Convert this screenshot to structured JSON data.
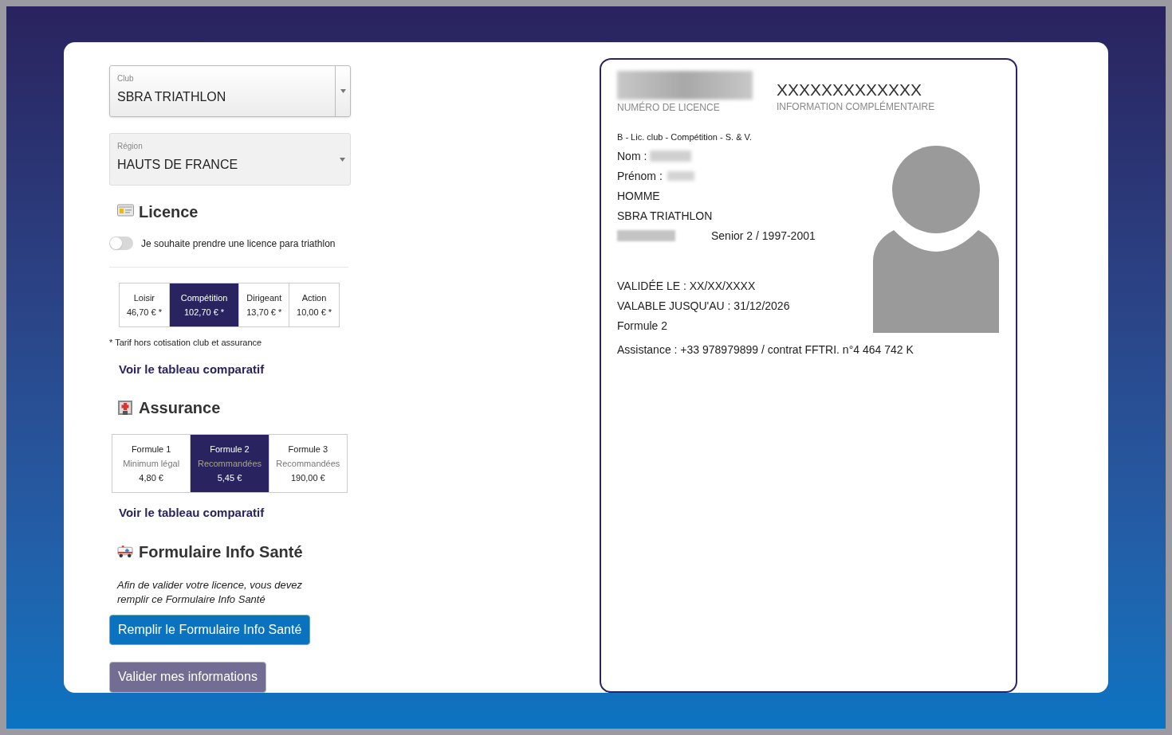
{
  "form": {
    "selects": [
      {
        "kind": "split",
        "label": "Club",
        "value": "SBRA TRIATHLON"
      },
      {
        "kind": "plain",
        "label": "Région",
        "value": "HAUTS DE FRANCE"
      }
    ],
    "licence": {
      "heading": "Licence",
      "toggle": {
        "label": "Je souhaite prendre une licence para triathlon",
        "on": false
      },
      "options": [
        {
          "name": "Loisir",
          "price": "46,70 € *",
          "selected": false
        },
        {
          "name": "Compétition",
          "price": "102,70 € *",
          "selected": true
        },
        {
          "name": "Dirigeant",
          "price": "13,70 € *",
          "selected": false
        },
        {
          "name": "Action",
          "price": "10,00 € *",
          "selected": false
        }
      ],
      "note": "* Tarif hors cotisation club et assurance",
      "link": "Voir le tableau comparatif"
    },
    "assurance": {
      "heading": "Assurance",
      "options": [
        {
          "name": "Formule 1",
          "subtitle": "Minimum légal",
          "price": "4,80 €",
          "selected": false
        },
        {
          "name": "Formule 2",
          "subtitle": "Recommandées",
          "price": "5,45 €",
          "selected": true
        },
        {
          "name": "Formule 3",
          "subtitle": "Recommandées",
          "price": "190,00 €",
          "selected": false
        }
      ],
      "link": "Voir le tableau comparatif"
    },
    "sante": {
      "heading": "Formulaire Info Santé",
      "text": "Afin de valider votre licence, vous devez remplir ce Formulaire Info Santé",
      "button": "Remplir le Formulaire Info Santé"
    },
    "submit_button": "Valider mes informations"
  },
  "card": {
    "number_label": "NUMÉRO DE LICENCE",
    "info_value": "XXXXXXXXXXXXX",
    "info_label": "INFORMATION COMPLÉMENTAIRE",
    "type": "B - Lic. club - Compétition - S. & V.",
    "nom_label": "Nom :",
    "prenom_label": "Prénom :",
    "sexe": "HOMME",
    "club": "SBRA TRIATHLON",
    "categorie": "Senior 2 / 1997-2001",
    "validee": "VALIDÉE LE : XX/XX/XXXX",
    "valable": "VALABLE JUSQU'AU : 31/12/2026",
    "formule": "Formule 2",
    "assistance": "Assistance : +33 978979899 / contrat FFTRI. n°4 464 742 K"
  }
}
